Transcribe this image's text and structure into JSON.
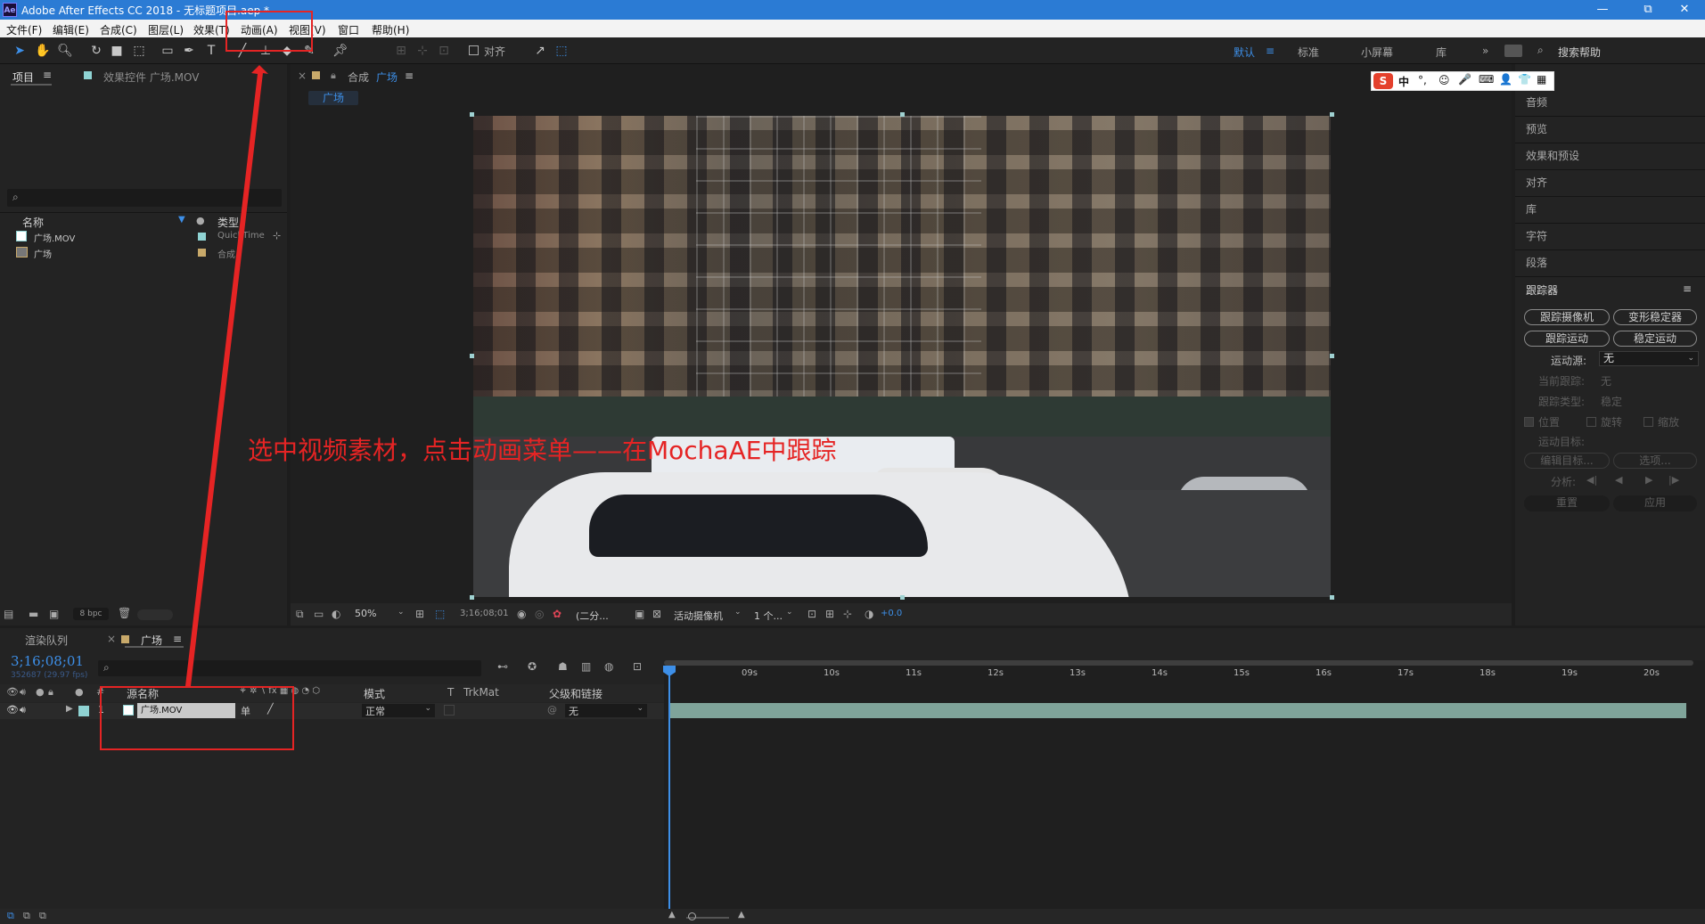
{
  "title_bar": {
    "app_icon": "Ae",
    "title": "Adobe After Effects CC 2018 - 无标题项目.aep *",
    "minimize": "—",
    "maximize": "⧉",
    "close": "✕"
  },
  "menu": [
    "文件(F)",
    "编辑(E)",
    "合成(C)",
    "图层(L)",
    "效果(T)",
    "动画(A)",
    "视图(V)",
    "窗口",
    "帮助(H)"
  ],
  "toolbar": {
    "align_label": "对齐",
    "workspaces": [
      "默认",
      "标准",
      "小屏幕",
      "库"
    ],
    "more": "»",
    "search_placeholder": "搜索帮助"
  },
  "project_panel": {
    "tab_label": "项目",
    "effects_tab_label": "效果控件 广场.MOV",
    "col_name": "名称",
    "col_type": "类型",
    "items": [
      {
        "name": "广场.MOV",
        "type": "QuickTime",
        "color": "#8fd3d3"
      },
      {
        "name": "广场",
        "type": "合成",
        "color": "#c8a96a"
      }
    ],
    "bpc": "8 bpc"
  },
  "comp_panel": {
    "tab_prefix": "合成",
    "tab_name": "广场",
    "subtab": "广场",
    "zoom": "50%",
    "timecode": "3;16;08;01",
    "resolution": "(二分...",
    "camera": "活动摄像机",
    "views": "1 个...",
    "exposure": "+0.0"
  },
  "right_panel": {
    "items": [
      "音频",
      "预览",
      "效果和预设",
      "对齐",
      "库",
      "字符",
      "段落"
    ],
    "tracker": {
      "title": "跟踪器",
      "btn_track_camera": "跟踪摄像机",
      "btn_warp_stabilizer": "变形稳定器",
      "btn_track_motion": "跟踪运动",
      "btn_stabilize_motion": "稳定运动",
      "motion_source_label": "运动源:",
      "motion_source_value": "无",
      "current_track_label": "当前跟踪:",
      "current_track_value": "无",
      "track_type_label": "跟踪类型:",
      "track_type_value": "稳定",
      "opt_position": "位置",
      "opt_rotation": "旋转",
      "opt_scale": "缩放",
      "motion_target_label": "运动目标:",
      "edit_target": "编辑目标...",
      "options": "选项...",
      "analyze_label": "分析:",
      "reset": "重置",
      "apply": "应用"
    }
  },
  "ime_bar": {
    "logo": "S",
    "items": [
      "中",
      "°,",
      "☺",
      "🎤",
      "⌨",
      "👤",
      "👕",
      "▦"
    ]
  },
  "timeline": {
    "render_queue_tab": "渲染队列",
    "comp_tab": "广场",
    "timecode": "3;16;08;01",
    "frame_info": "352687 (29.97 fps)",
    "col_source_name": "源名称",
    "col_mode": "模式",
    "col_t": "T",
    "col_trkmat": "TrkMat",
    "col_parent": "父级和链接",
    "layer": {
      "index": "1",
      "name": "广场.MOV",
      "mode": "正常",
      "parent": "无",
      "switch": "单"
    },
    "ruler": [
      "09s",
      "10s",
      "11s",
      "12s",
      "13s",
      "14s",
      "15s",
      "16s",
      "17s",
      "18s",
      "19s",
      "20s"
    ]
  },
  "annotation": {
    "text": "选中视频素材，点击动画菜单——在MochaAE中跟踪",
    "color": "#e52424"
  }
}
